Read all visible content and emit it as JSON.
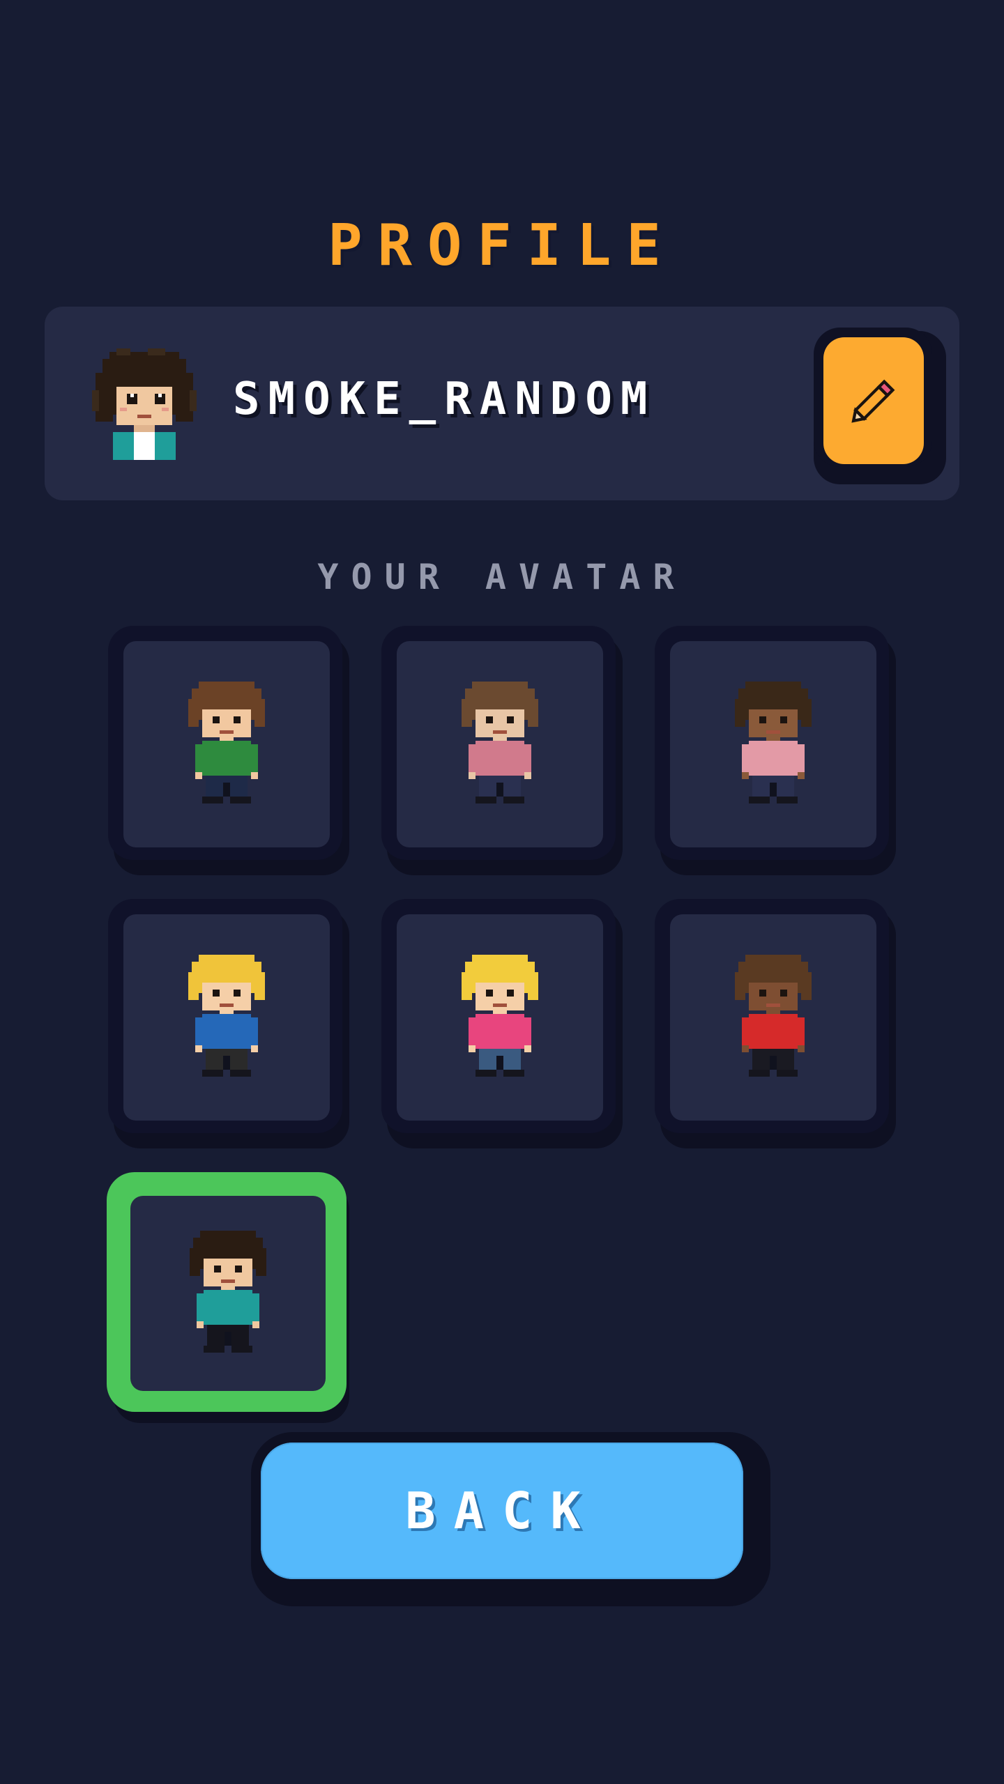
{
  "title": "PROFILE",
  "profile": {
    "username": "SMOKE_RANDOM",
    "avatar_icon": "curly-hair-character-avatar",
    "edit_icon": "pencil-icon"
  },
  "avatar_section": {
    "heading": "YOUR AVATAR",
    "selected_index": 6,
    "avatars": [
      {
        "name": "brown-hair-boy-green-sweater",
        "hair": "#6b4226",
        "skin": "#f2c8a0",
        "shirt": "#2e8b3e",
        "pants": "#1e2a48"
      },
      {
        "name": "brown-hair-girl-pink-sweater",
        "hair": "#6b4a30",
        "skin": "#e8c6a6",
        "shirt": "#d17a8c",
        "pants": "#2a3050"
      },
      {
        "name": "dark-curly-hair-pink-sweater",
        "hair": "#3a2818",
        "skin": "#8a5a3a",
        "shirt": "#e39aa6",
        "pants": "#2a3050"
      },
      {
        "name": "blonde-boy-blue-hoodie",
        "hair": "#f0c43a",
        "skin": "#f5cfa8",
        "shirt": "#2568b8",
        "pants": "#2a2a2a"
      },
      {
        "name": "blonde-girl-pink-shirt",
        "hair": "#f2cc3c",
        "skin": "#f5cfa8",
        "shirt": "#e8457e",
        "pants": "#3a5a80"
      },
      {
        "name": "brown-hair-red-shirt",
        "hair": "#5a3a22",
        "skin": "#7e4e32",
        "shirt": "#d62a2a",
        "pants": "#1a1a22"
      },
      {
        "name": "curly-hair-teal-jacket",
        "hair": "#2a1c12",
        "skin": "#f0c8a0",
        "shirt": "#1f9e9a",
        "pants": "#15151d"
      }
    ]
  },
  "back_button": {
    "label": "BACK"
  },
  "colors": {
    "background": "#171c33",
    "card": "#252a45",
    "accent_orange": "#ffa62b",
    "selected_green": "#4cc65a",
    "back_blue": "#55b9fb"
  }
}
